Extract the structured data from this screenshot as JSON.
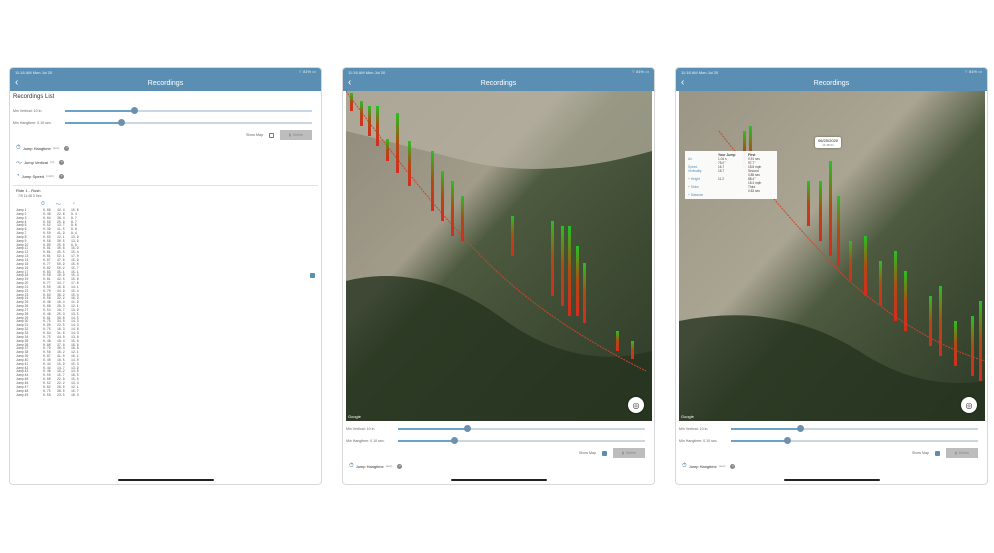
{
  "status": {
    "time": "11:16 AM  Mon Jul 20",
    "right": "⌔ 81% ▭"
  },
  "nav": {
    "back_icon": "back-arrow",
    "title": "Recordings"
  },
  "recordings_list_title": "Recordings List",
  "filters": {
    "min_vertical_label": "Min Vertical: 10 in.",
    "min_vertical_fraction": 0.28,
    "min_hangtime_label": "Min Hangtime: 0.10 sec.",
    "min_hangtime_fraction": 0.23
  },
  "show_map_label": "Show Map",
  "delete_label": "Delete",
  "legend": [
    {
      "label": "Jump Hangtime",
      "unit": "(sec)"
    },
    {
      "label": "Jump  Vertical",
      "unit": "(in)"
    },
    {
      "label": "Jump Speed",
      "unit": "(mph)"
    }
  ],
  "ride": {
    "title": "Ride 1 - Rush",
    "sub": "7/9 11:48   3 Sec"
  },
  "jumps": [
    [
      "Jump 1",
      "0.66",
      "42.4",
      "15.6"
    ],
    [
      "Jump 2",
      "0.48",
      "22.6",
      "9.4"
    ],
    [
      "Jump 3",
      "0.64",
      "38.4",
      "8.7"
    ],
    [
      "Jump 4",
      "0.50",
      "25.9",
      "8.7"
    ],
    [
      "Jump 5",
      "0.52",
      "13.7",
      "8.6"
    ],
    [
      "Jump 6",
      "0.39",
      "11.5",
      "8.8"
    ],
    [
      "Jump 7",
      "0.50",
      "41.9",
      "8.4"
    ],
    [
      "Jump 8",
      "0.63",
      "12.1",
      "13.9"
    ],
    [
      "Jump 9",
      "0.56",
      "30.5",
      "13.9"
    ],
    [
      "Jump 10",
      "0.90",
      "25.0",
      "9.6"
    ],
    [
      "Jump 11",
      "0.81",
      "40.6",
      "15.9"
    ],
    [
      "Jump 12",
      "0.81",
      "45.5",
      "15.4"
    ],
    [
      "Jump 13",
      "0.61",
      "52.1",
      "17.0"
    ],
    [
      "Jump 14",
      "0.87",
      "47.6",
      "15.9"
    ],
    [
      "Jump 15",
      "0.77",
      "50.9",
      "15.0"
    ],
    [
      "Jump 16",
      "0.82",
      "50.2",
      "15.7"
    ],
    [
      "Jump 17",
      "0.83",
      "35.1",
      "15.1"
    ],
    [
      "Jump 18",
      "0.56",
      "16.9",
      "15.3"
    ],
    [
      "Jump 19",
      "0.81",
      "42.5",
      "15.6"
    ],
    [
      "Jump 20",
      "0.77",
      "44.7",
      "17.6"
    ],
    [
      "Jump 21",
      "0.50",
      "16.8",
      "14.1"
    ],
    [
      "Jump 22",
      "0.70",
      "44.9",
      "15.4"
    ],
    [
      "Jump 23",
      "0.63",
      "38.2",
      "15.4"
    ],
    [
      "Jump 24",
      "0.58",
      "32.2",
      "16.3"
    ],
    [
      "Jump 25",
      "0.46",
      "18.4",
      "11.9"
    ],
    [
      "Jump 26",
      "0.68",
      "26.3",
      "12.1"
    ],
    [
      "Jump 27",
      "0.54",
      "18.7",
      "13.9"
    ],
    [
      "Jump 28",
      "0.46",
      "25.3",
      "13.5"
    ],
    [
      "Jump 29",
      "0.81",
      "39.8",
      "14.5"
    ],
    [
      "Jump 30",
      "0.75",
      "34.0",
      "14.3"
    ],
    [
      "Jump 31",
      "0.90",
      "22.5",
      "14.3"
    ],
    [
      "Jump 32",
      "0.75",
      "18.3",
      "14.6"
    ],
    [
      "Jump 33",
      "0.64",
      "31.6",
      "14.3"
    ],
    [
      "Jump 34",
      "0.75",
      "44.0",
      "13.8"
    ],
    [
      "Jump 35",
      "0.46",
      "18.4",
      "15.8"
    ],
    [
      "Jump 36",
      "0.80",
      "37.8",
      "16.6"
    ],
    [
      "Jump 37",
      "0.79",
      "40.4",
      "16.8"
    ],
    [
      "Jump 38",
      "0.56",
      "16.2",
      "12.1"
    ],
    [
      "Jump 39",
      "0.87",
      "41.0",
      "16.1"
    ],
    [
      "Jump 40",
      "0.40",
      "18.5",
      "14.0"
    ],
    [
      "Jump 41",
      "0.44",
      "15.9",
      "15.3"
    ],
    [
      "Jump 42",
      "0.44",
      "14.7",
      "13.9"
    ],
    [
      "Jump 43",
      "0.46",
      "19.2",
      "14.0"
    ],
    [
      "Jump 44",
      "0.50",
      "15.7",
      "18.5"
    ],
    [
      "Jump 45",
      "0.60",
      "22.8",
      "15.0"
    ],
    [
      "Jump 46",
      "0.52",
      "22.2",
      "13.4"
    ],
    [
      "Jump 47",
      "0.62",
      "26.0",
      "12.1"
    ],
    [
      "Jump 48",
      "0.75",
      "36.0",
      "15.7"
    ],
    [
      "Jump 49",
      "0.58",
      "23.5",
      "16.3"
    ]
  ],
  "map": {
    "attribution": "Google",
    "locate_icon": "locate-icon"
  },
  "popup": {
    "date": "06/25/2020",
    "date_sub": "11:48:21",
    "col_your_jump": "Your Jump",
    "col_first": "First",
    "rows": [
      {
        "label": "Air",
        "value": "1.04 s",
        "rank": "0.91 sec"
      },
      {
        "label": "",
        "value": "75.0\"",
        "rank": "97.7\""
      },
      {
        "label": "Speed",
        "value": "16.7",
        "rank": "18.8 mph"
      },
      {
        "label": "Verticality",
        "value": "15.7",
        "rank": "Second"
      },
      {
        "label": "",
        "value": "",
        "rank": "0.85 sec"
      },
      {
        "label": "+ Height",
        "value": "11.2",
        "rank": "88.4\""
      },
      {
        "label": "",
        "value": "",
        "rank": "18.4 mph"
      },
      {
        "label": "+ Stoke",
        "value": "",
        "rank": "Third"
      },
      {
        "label": "",
        "value": "",
        "rank": "0.83 sec"
      },
      {
        "label": "+ Distance",
        "value": "",
        "rank": ""
      }
    ]
  },
  "colors": {
    "nav": "#5a8fb3",
    "accent": "#6aa2c8",
    "bar_high": "#22c322",
    "bar_low": "#d72b1f"
  }
}
